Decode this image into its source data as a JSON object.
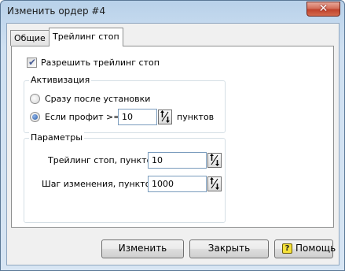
{
  "window": {
    "title": "Изменить ордер #4",
    "close_glyph": "✕",
    "colors": {
      "titlebar_top": "#b8d1e9",
      "client": "#f0f0f0",
      "close_button": "#c0432c"
    }
  },
  "tabs": [
    {
      "label": "Общие",
      "active": false
    },
    {
      "label": "Трейлинг стоп",
      "active": true
    }
  ],
  "trailing": {
    "enable_label": "Разрешить трейлинг стоп",
    "enable_checked": true,
    "activation": {
      "title": "Активизация",
      "option_immediate": "Сразу после установки",
      "option_profit": "Если профит >=",
      "selected": "profit",
      "profit_value": "10",
      "points_label": "пунктов"
    },
    "parameters": {
      "title": "Параметры",
      "trail_label": "Трейлинг стоп, пунктов:",
      "trail_value": "10",
      "step_label": "Шаг изменения, пунктов:",
      "step_value": "1000"
    }
  },
  "buttons": {
    "modify": "Изменить",
    "close": "Закрыть",
    "help": "Помощь",
    "help_icon": "?"
  },
  "icons": [
    "close-icon",
    "checkmark-icon",
    "spinner-arrows-icon",
    "help-icon"
  ]
}
